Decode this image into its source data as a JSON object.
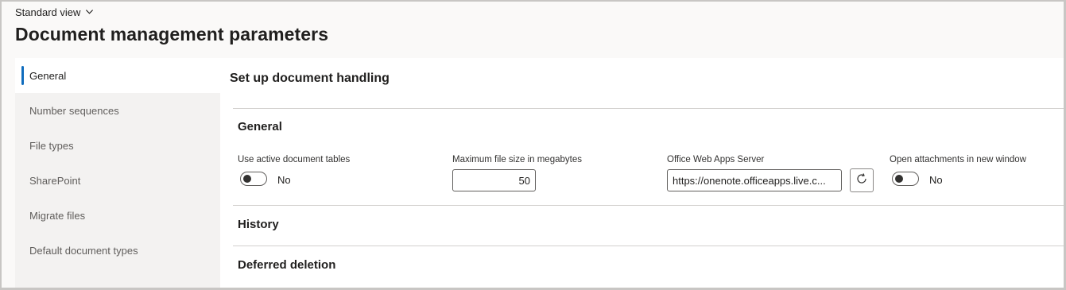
{
  "header": {
    "view_label": "Standard view",
    "title": "Document management parameters"
  },
  "sidebar": {
    "items": [
      {
        "label": "General"
      },
      {
        "label": "Number sequences"
      },
      {
        "label": "File types"
      },
      {
        "label": "SharePoint"
      },
      {
        "label": "Migrate files"
      },
      {
        "label": "Default document types"
      }
    ],
    "active_index": 0
  },
  "main": {
    "section_title": "Set up document handling",
    "groups": {
      "general": {
        "title": "General",
        "use_active_document_tables": {
          "label": "Use active document tables",
          "value": "No"
        },
        "max_file_size": {
          "label": "Maximum file size in megabytes",
          "value": "50"
        },
        "office_web_apps_server": {
          "label": "Office Web Apps Server",
          "value": "https://onenote.officeapps.live.c..."
        },
        "open_attachments_new_window": {
          "label": "Open attachments in new window",
          "value": "No"
        }
      },
      "history": {
        "title": "History"
      },
      "deferred_deletion": {
        "title": "Deferred deletion"
      }
    }
  },
  "colors": {
    "accent": "#0f6cbd",
    "sidebar_bg": "#f3f2f1",
    "page_bg": "#faf9f8"
  }
}
